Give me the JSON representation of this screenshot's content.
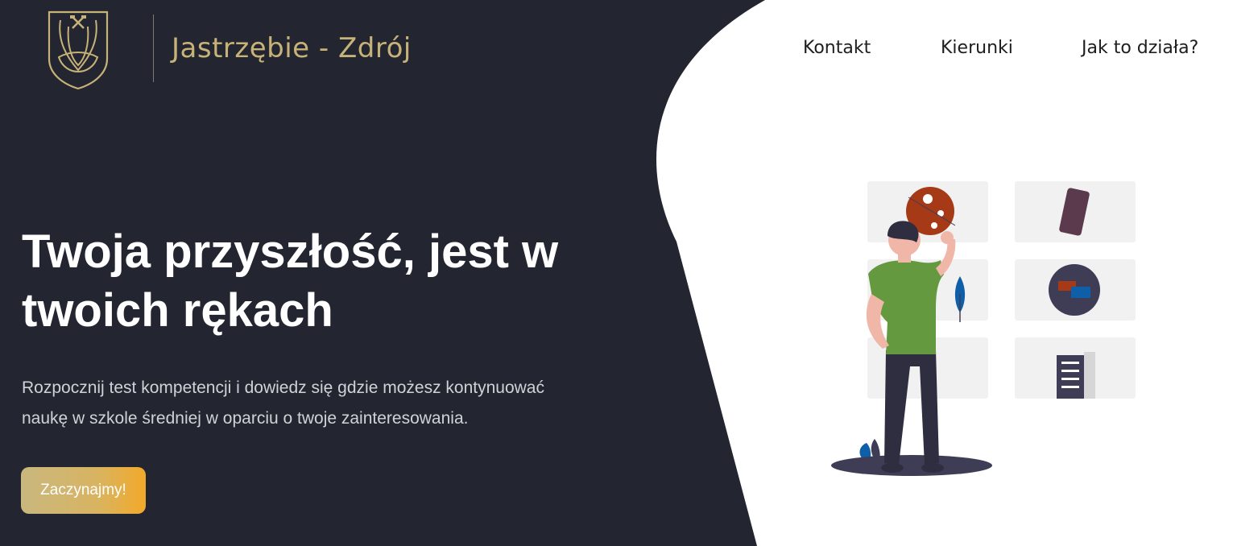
{
  "header": {
    "brand": "Jastrzębie - Zdrój",
    "logo_icon": "coat-of-arms-icon"
  },
  "nav": {
    "items": [
      {
        "label": "Kontakt"
      },
      {
        "label": "Kierunki"
      },
      {
        "label": "Jak to działa?"
      }
    ]
  },
  "hero": {
    "title_line1": "Twoja przyszłość, jest w",
    "title_line2": "twoich rękach",
    "subtitle_line1": "Rozpocznij test kompetencji i dowiedz się gdzie możesz kontynuować",
    "subtitle_line2": "naukę w szkole średniej w oparciu o twoje zainteresowania.",
    "cta_label": "Zaczynajmy!"
  },
  "colors": {
    "dark_background": "#232630",
    "brand_gold": "#c7b378",
    "cta_gradient_start": "#c9b77e",
    "cta_gradient_end": "#f2a92a",
    "illustration_shirt": "#64993f",
    "illustration_accent": "#a63a17",
    "illustration_blue": "#0f5fa8"
  },
  "illustration": {
    "icon": "person-choosing-career-illustration"
  }
}
